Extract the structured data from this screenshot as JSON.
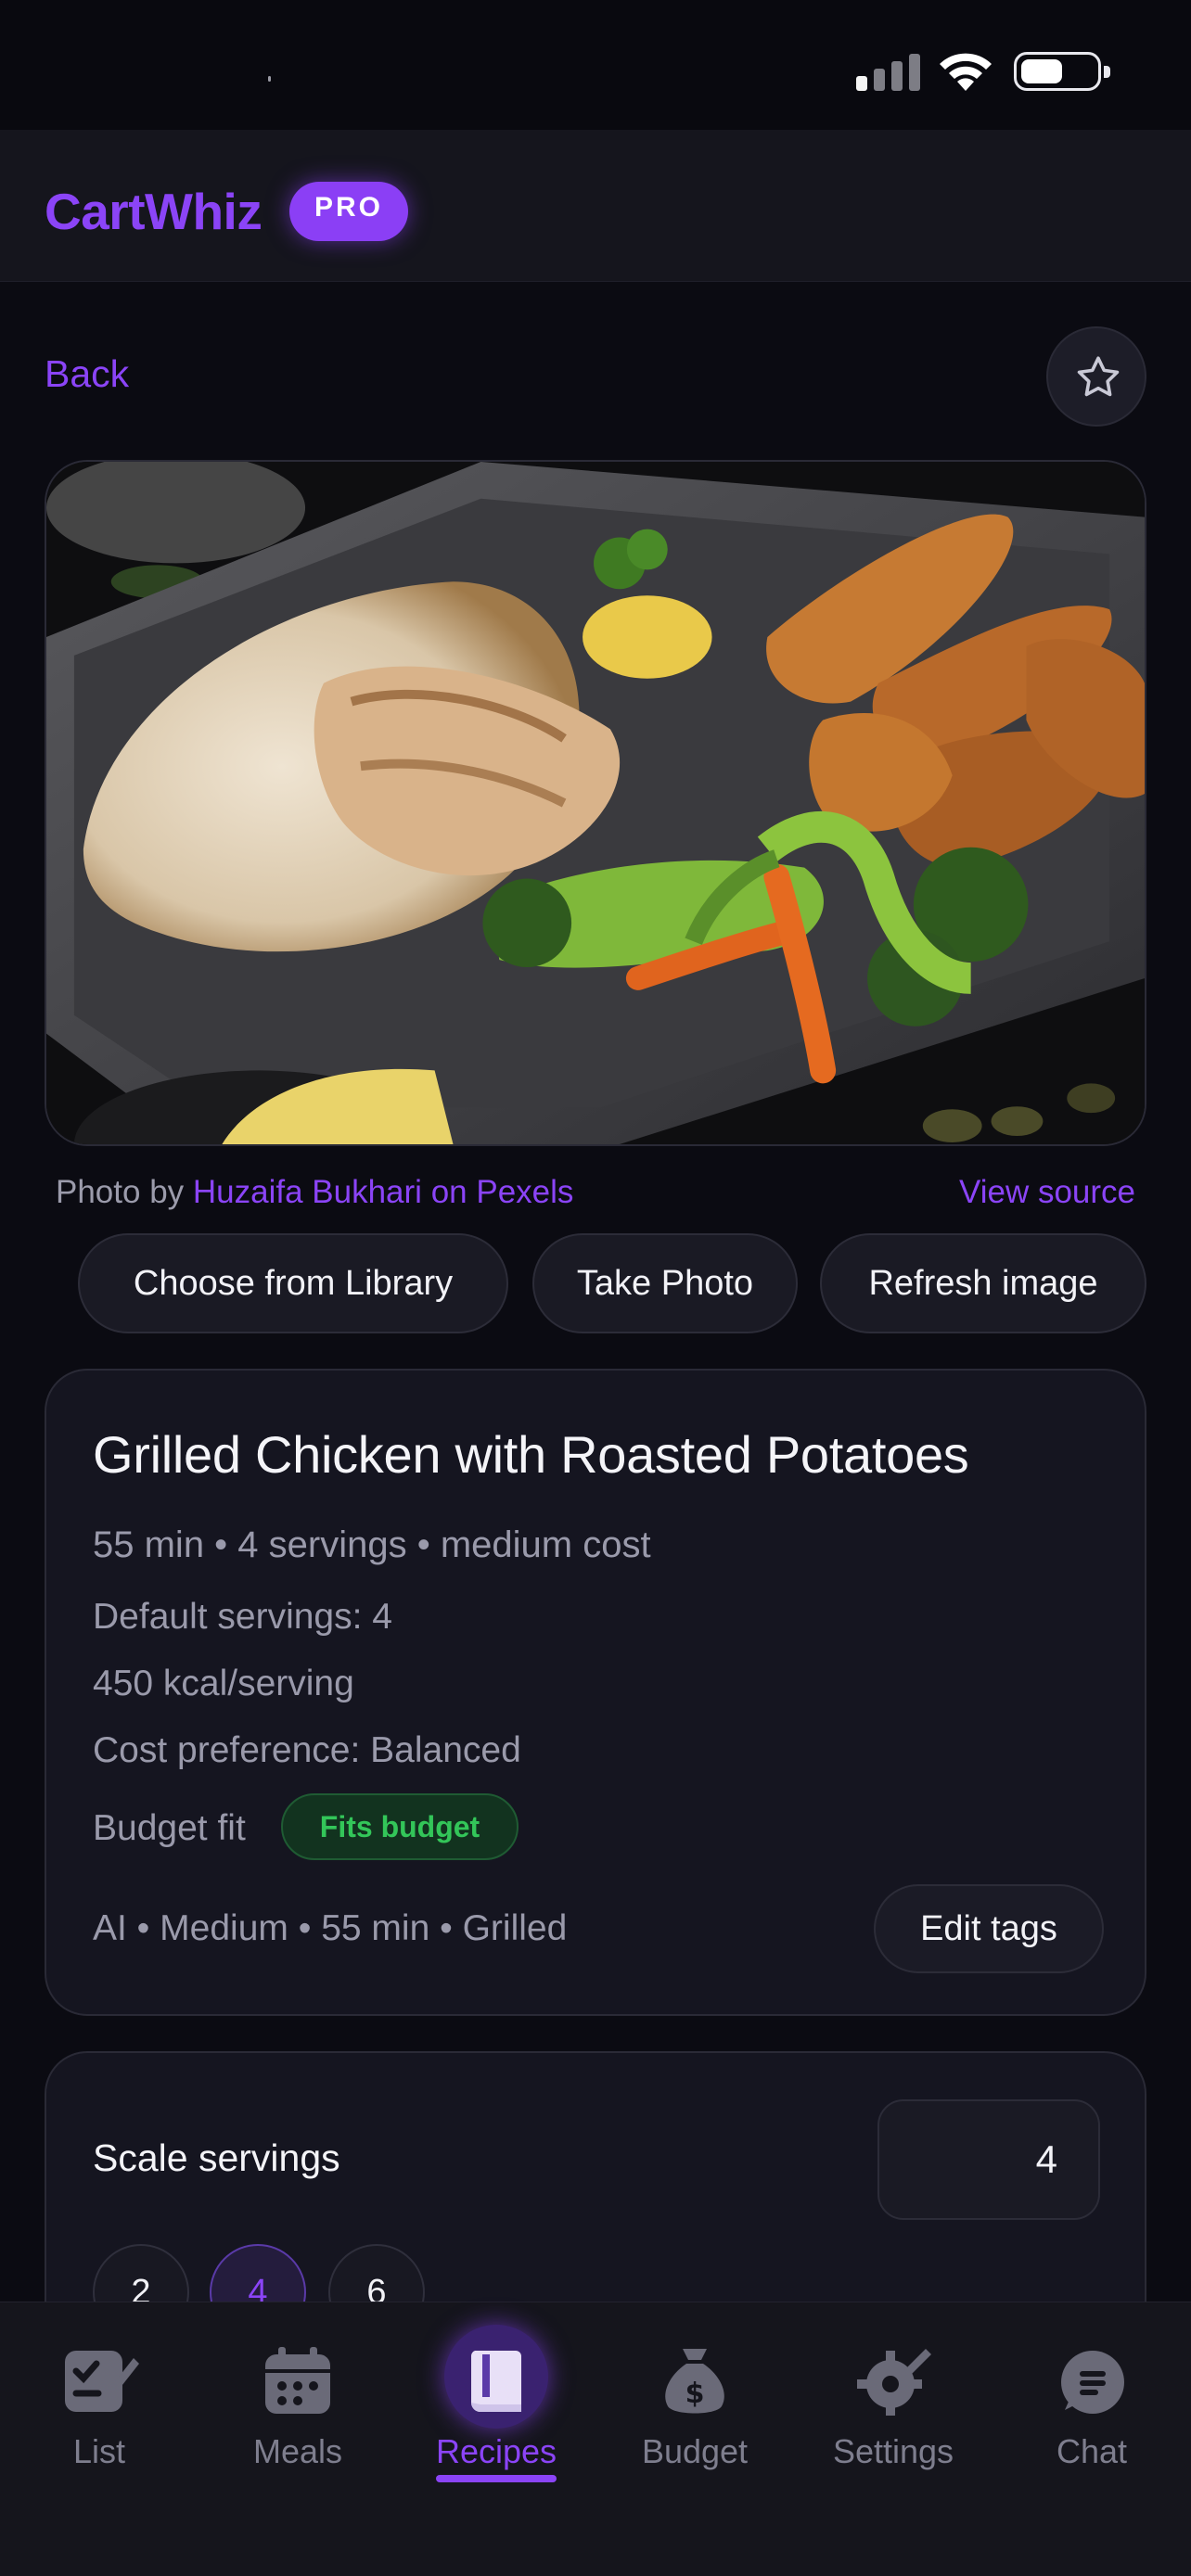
{
  "app": {
    "name": "CartWhiz",
    "badge": "PRO"
  },
  "nav": {
    "back_label": "Back"
  },
  "photo": {
    "credit_prefix": "Photo by ",
    "photographer": "Huzaifa Bukhari",
    "credit_suffix": " on Pexels",
    "view_source": "View source"
  },
  "photo_actions": {
    "library": "Choose from Library",
    "take_photo": "Take Photo",
    "refresh": "Refresh image"
  },
  "recipe": {
    "title": "Grilled Chicken with Roasted Potatoes",
    "summary": "55 min • 4 servings • medium cost",
    "default_servings": "Default servings: 4",
    "calories": "450 kcal/serving",
    "cost_preference": "Cost preference: Balanced",
    "budget_fit_label": "Budget fit",
    "budget_fit_status": "Fits budget",
    "tags": "AI • Medium • 55 min • Grilled",
    "edit_tags": "Edit tags"
  },
  "scale": {
    "label": "Scale servings",
    "value": "4",
    "options": [
      "2",
      "4",
      "6"
    ],
    "selected": "4"
  },
  "tabs": [
    {
      "label": "List",
      "icon": "checklist-icon"
    },
    {
      "label": "Meals",
      "icon": "calendar-icon"
    },
    {
      "label": "Recipes",
      "icon": "book-icon",
      "active": true
    },
    {
      "label": "Budget",
      "icon": "money-bag-icon"
    },
    {
      "label": "Settings",
      "icon": "gear-icon"
    },
    {
      "label": "Chat",
      "icon": "chat-icon"
    }
  ],
  "colors": {
    "accent": "#8b44f7",
    "background": "#0b0b12",
    "card": "#151520",
    "success": "#33c659"
  }
}
